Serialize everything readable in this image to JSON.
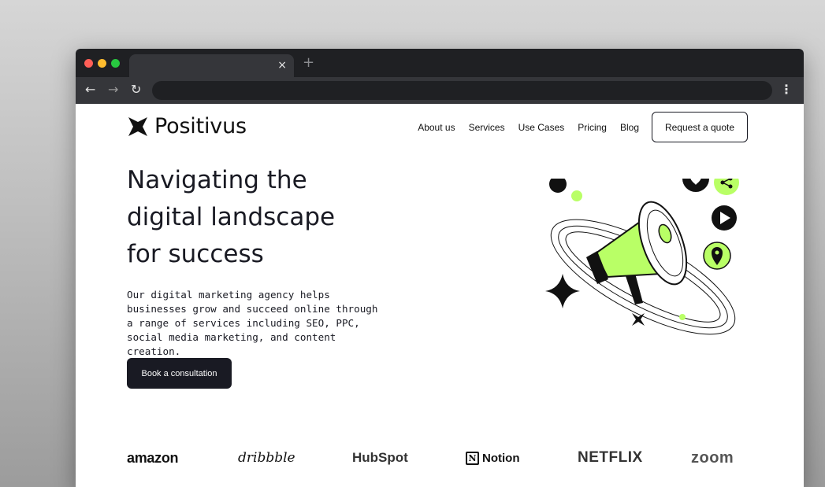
{
  "browser": {
    "tab_close": "×",
    "new_tab": "+",
    "back": "←",
    "forward": "→",
    "reload": "↻",
    "menu": "⋮"
  },
  "site": {
    "brand": "Positivus",
    "nav": [
      "About us",
      "Services",
      "Use Cases",
      "Pricing",
      "Blog"
    ],
    "quote_button": "Request a quote"
  },
  "hero": {
    "title_lines": [
      "Navigating the",
      "digital landscape",
      "for success"
    ],
    "description": "Our digital marketing agency helps businesses grow and succeed online through a range of services including SEO, PPC, social media marketing, and content creation.",
    "cta": "Book a consultation"
  },
  "brands": {
    "amazon": "amazon",
    "dribbble": "dribbble",
    "hubspot": "HubSpot",
    "notion": "Notion",
    "notion_mark": "N",
    "netflix": "NETFLIX",
    "zoom": "zoom"
  },
  "colors": {
    "accent": "#b9ff66",
    "dark": "#191a23"
  }
}
